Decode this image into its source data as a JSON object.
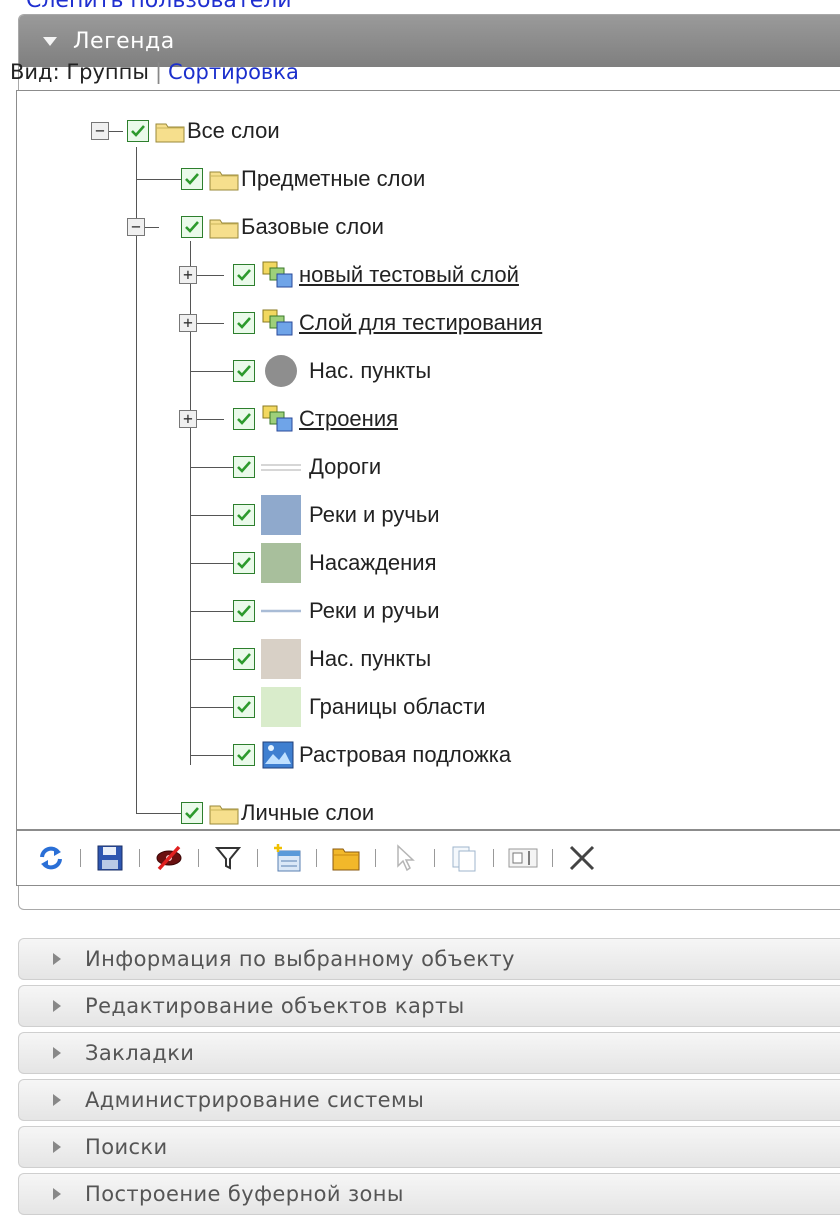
{
  "top_cut_text": "Слепить пользователи",
  "legend": {
    "title": "Легенда",
    "view_label": "Вид:",
    "view_groups": "Группы",
    "view_sort": "Сортировка"
  },
  "tree": [
    {
      "label": "Все слои",
      "checked": true
    },
    {
      "label": "Предметные слои",
      "checked": true
    },
    {
      "label": "Базовые слои",
      "checked": true
    },
    {
      "label": "новый тестовый слой",
      "checked": true
    },
    {
      "label": "Слой для тестирования",
      "checked": true
    },
    {
      "label": "Нас. пункты",
      "checked": true
    },
    {
      "label": "Строения",
      "checked": true
    },
    {
      "label": "Дороги",
      "checked": true
    },
    {
      "label": "Реки и ручьи",
      "checked": true
    },
    {
      "label": "Насаждения",
      "checked": true
    },
    {
      "label": "Реки и ручьи",
      "checked": true
    },
    {
      "label": "Нас. пункты",
      "checked": true
    },
    {
      "label": "Границы области",
      "checked": true
    },
    {
      "label": "Растровая подложка",
      "checked": true
    },
    {
      "label": "Личные слои",
      "checked": true
    }
  ],
  "toolbar_icons": [
    "refresh-icon",
    "save-icon",
    "hide-icon",
    "filter-icon",
    "add-layer-icon",
    "folder-icon",
    "select-cursor-icon",
    "copy-icon",
    "rename-icon",
    "delete-icon"
  ],
  "accordion": [
    "Информация по выбранному объекту",
    "Редактирование объектов карты",
    "Закладки",
    "Администрирование системы",
    "Поиски",
    "Построение буферной зоны"
  ],
  "colors": {
    "header_bg": "#8a8a8a",
    "link": "#1b2fcc",
    "check": "#2d9a2d",
    "river_fill": "#8fa9cc",
    "vegetation_fill": "#a8bf9c",
    "settlement_fill": "#d8d0c6",
    "boundary_fill": "#d9eccb"
  }
}
